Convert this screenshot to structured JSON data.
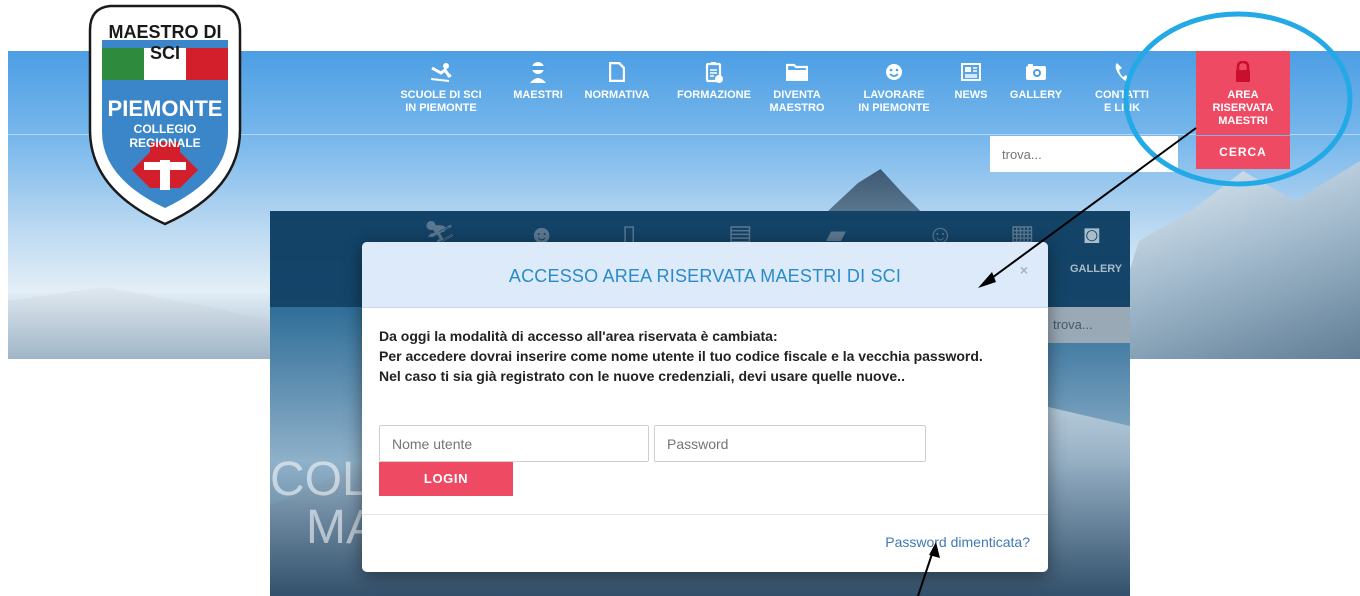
{
  "top_nav": {
    "items": [
      {
        "label": "SCUOLE DI SCI\nIN PIEMONTE",
        "icon": "skier-icon"
      },
      {
        "label": "MAESTRI",
        "icon": "instructor-icon"
      },
      {
        "label": "NORMATIVA",
        "icon": "document-icon"
      },
      {
        "label": "FORMAZIONE",
        "icon": "clipboard-check-icon"
      },
      {
        "label": "DIVENTA\nMAESTRO",
        "icon": "folder-icon"
      },
      {
        "label": "LAVORARE\nIN PIEMONTE",
        "icon": "smiley-icon"
      },
      {
        "label": "NEWS",
        "icon": "newspaper-icon"
      },
      {
        "label": "GALLERY",
        "icon": "camera-icon"
      },
      {
        "label": "CONTATTI\nE LINK",
        "icon": "phone-icon"
      }
    ],
    "reserved_area": {
      "label": "AREA RISERVATA\nMAESTRI",
      "icon": "lock-icon"
    },
    "search": {
      "placeholder": "trova...",
      "button_label": "CERCA"
    }
  },
  "logo": {
    "line1": "MAESTRO DI SCI",
    "line2": "PIEMONTE",
    "line3": "COLLEGIO",
    "line4": "REGIONALE"
  },
  "background_page": {
    "gallery_label": "GALLERY",
    "search_placeholder": "trova...",
    "hero_text_line1": "COL",
    "hero_text_line2": "MA"
  },
  "modal": {
    "title": "ACCESSO AREA RISERVATA MAESTRI DI SCI",
    "close_label": "×",
    "message_lines": [
      "Da oggi la modalità di accesso all'area riservata è cambiata:",
      "Per accedere dovrai inserire come nome utente il tuo codice fiscale e la vecchia password.",
      "Nel caso ti sia già registrato con le nuove credenziali, devi usare quelle nuove.."
    ],
    "username_placeholder": "Nome utente",
    "password_placeholder": "Password",
    "login_label": "LOGIN",
    "forgot_password_label": "Password dimenticata?"
  },
  "colors": {
    "accent_red": "#ee4a64",
    "nav_blue": "#4c9ee4",
    "modal_title_blue": "#2a8bc9",
    "modal_header_bg": "#dceafa",
    "annotation_circle": "#22a9e6"
  }
}
